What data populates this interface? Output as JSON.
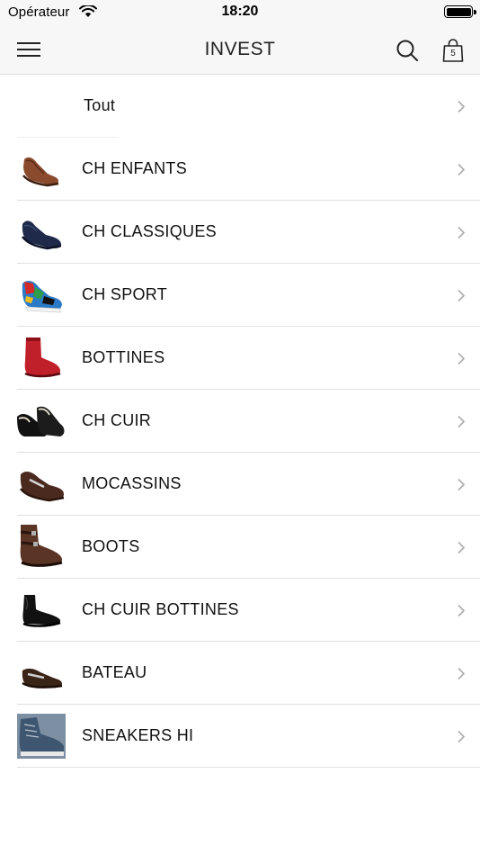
{
  "status_bar": {
    "carrier": "Opérateur",
    "time": "18:20"
  },
  "nav": {
    "title": "INVEST",
    "cart_count": "5"
  },
  "categories": [
    {
      "label": "Tout",
      "thumb": "none"
    },
    {
      "label": "CH ENFANTS",
      "thumb": "brown-derby-shoe"
    },
    {
      "label": "CH CLASSIQUES",
      "thumb": "navy-suede-shoe"
    },
    {
      "label": "CH SPORT",
      "thumb": "colorful-sneaker"
    },
    {
      "label": "BOTTINES",
      "thumb": "red-chelsea-boot"
    },
    {
      "label": "CH CUIR",
      "thumb": "black-velvet-loafers"
    },
    {
      "label": "MOCASSINS",
      "thumb": "brown-moccasin"
    },
    {
      "label": "BOOTS",
      "thumb": "brown-buckle-boot"
    },
    {
      "label": "CH CUIR BOTTINES",
      "thumb": "black-leather-ankle-boot"
    },
    {
      "label": "BATEAU",
      "thumb": "brown-boat-shoe"
    },
    {
      "label": "SNEAKERS HI",
      "thumb": "blue-high-top-sneaker"
    }
  ]
}
